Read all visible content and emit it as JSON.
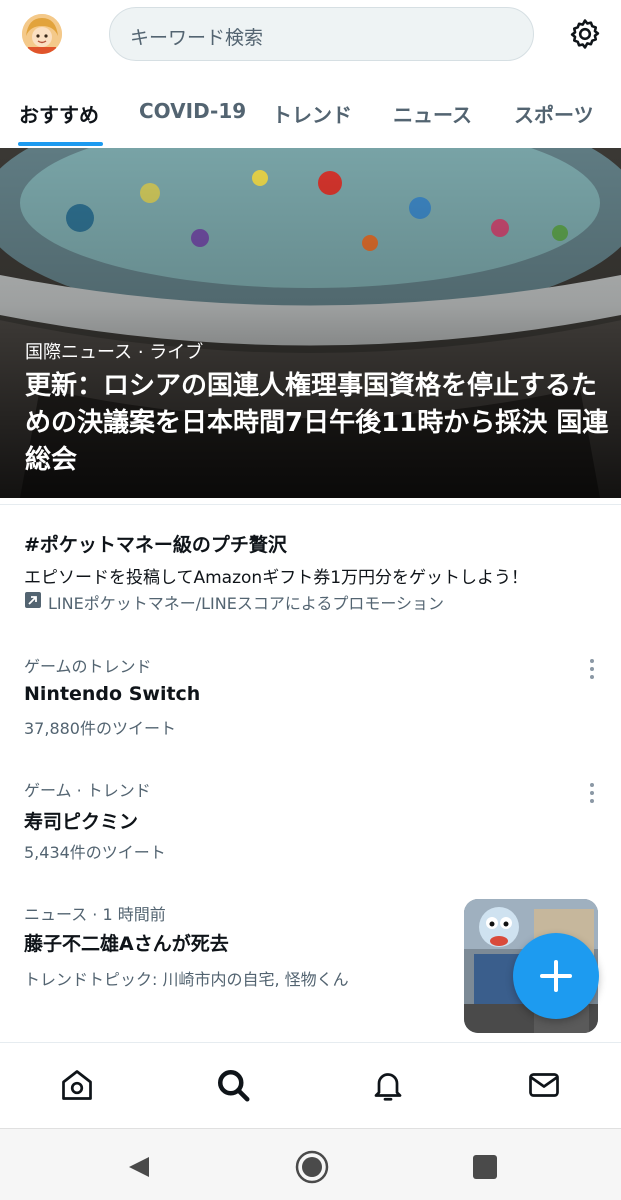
{
  "header": {
    "search_placeholder": "キーワード検索"
  },
  "tabs": [
    {
      "label": "おすすめ",
      "active": true
    },
    {
      "label": "COVID-19",
      "active": false
    },
    {
      "label": "トレンド",
      "active": false
    },
    {
      "label": "ニュース",
      "active": false
    },
    {
      "label": "スポーツ",
      "active": false
    }
  ],
  "hero": {
    "category": "国際ニュース · ライブ",
    "title": "更新：ロシアの国連人権理事国資格を停止するための決議案を日本時間7日午後11時から採決 国連総会"
  },
  "promo": {
    "title": "#ポケットマネー級のプチ贅沢",
    "description": "エピソードを投稿してAmazonギフト券1万円分をゲットしよう！",
    "sponsor": "LINEポケットマネー/LINEスコアによるプロモーション"
  },
  "trends": [
    {
      "meta": "ゲームのトレンド",
      "name": "Nintendo Switch",
      "count": "37,880件のツイート"
    },
    {
      "meta": "ゲーム · トレンド",
      "name": "寿司ピクミン",
      "count": "5,434件のツイート"
    }
  ],
  "news": {
    "meta": "ニュース · 1 時間前",
    "title": "藤子不二雄Aさんが死去",
    "topic": "トレンドトピック: 川崎市内の自宅, 怪物くん"
  },
  "colors": {
    "accent": "#1d9bf0",
    "secondary_text": "#536471",
    "primary_text": "#0f1419"
  },
  "icons": {
    "header": [
      "avatar",
      "gear-icon"
    ],
    "bottom_nav": [
      "home-icon",
      "search-icon",
      "bell-icon",
      "mail-icon"
    ],
    "system_nav": [
      "back-icon",
      "home-circle-icon",
      "recents-icon"
    ]
  }
}
